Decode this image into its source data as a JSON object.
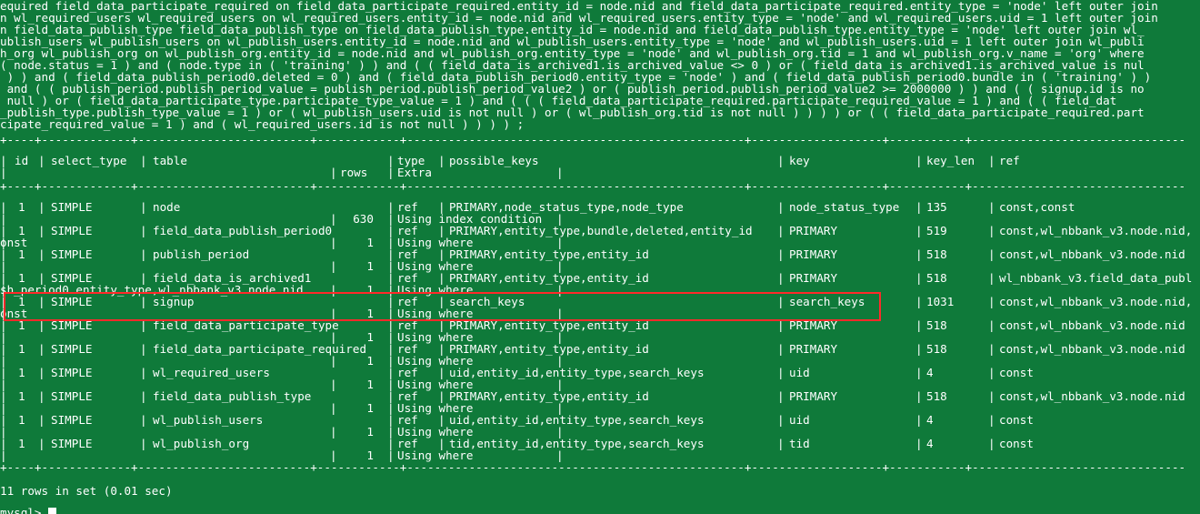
{
  "sql": {
    "lines": [
      "equired field_data_participate_required on field_data_participate_required.entity_id = node.nid and field_data_participate_required.entity_type = 'node' left outer join",
      "n wl_required_users wl_required_users on wl_required_users.entity_id = node.nid and wl_required_users.entity_type = 'node' and wl_required_users.uid = 1 left outer join",
      "n field_data_publish_type field_data_publish_type on field_data_publish_type.entity_id = node.nid and field_data_publish_type.entity_type = 'node' left outer join wl_",
      "ublish_users wl_publish_users on wl_publish_users.entity_id = node.nid and wl_publish_users.entity_type = 'node' and wl_publish_users.uid = 1 left outer join wl_publi",
      "h_org wl_publish_org on wl_publish_org.entity_id = node.nid and wl_publish_org.entity_type = 'node' and wl_publish_org.tid = 1 and wl_publish_org.v_name = 'org' where",
      "( node.status = 1 ) and ( node.type in ( 'training' ) ) and ( ( field_data_is_archived1.is_archived_value <> 0 ) or ( field_data_is_archived1.is_archived_value is nul",
      " ) ) and ( field_data_publish_period0.deleted = 0 ) and ( field_data_publish_period0.entity_type = 'node' ) and ( field_data_publish_period0.bundle in ( 'training' ) )",
      " and ( ( publish_period.publish_period_value = publish_period.publish_period_value2 ) or ( publish_period.publish_period_value2 >= 2000000 ) ) and ( ( signup.id is no",
      " null ) or ( field_data_participate_type.participate_type_value = 1 ) and ( ( ( field_data_participate_required.participate_required_value = 1 ) and ( ( field_dat",
      "_publish_type.publish_type_value = 1 ) or ( wl_publish_users.uid is not null ) or ( wl_publish_org.tid is not null ) ) ) ) or ( ( field_data_participate_required.part",
      "cipate_required_value = 1 ) and ( wl_required_users.id is not null ) ) ) ) ;"
    ]
  },
  "table": {
    "headers": {
      "id": "id",
      "select_type": "select_type",
      "table": "table",
      "type": "type",
      "possible_keys": "possible_keys",
      "key": "key",
      "key_len": "key_len",
      "ref": "ref",
      "rows": "rows",
      "extra": "Extra"
    },
    "rows": [
      {
        "id": "1",
        "select_type": "SIMPLE",
        "table": "node",
        "type": "ref",
        "possible_keys": "PRIMARY,node_status_type,node_type",
        "key": "node_status_type",
        "key_len": "135",
        "ref": "const,const",
        "rows": "630",
        "extra": "Using index condition",
        "overflow": ""
      },
      {
        "id": "1",
        "select_type": "SIMPLE",
        "table": "field_data_publish_period0",
        "type": "ref",
        "possible_keys": "PRIMARY,entity_type,bundle,deleted,entity_id",
        "key": "PRIMARY",
        "key_len": "519",
        "ref": "const,wl_nbbank_v3.node.nid,",
        "rows": "1",
        "extra": "Using where",
        "overflow": "onst"
      },
      {
        "id": "1",
        "select_type": "SIMPLE",
        "table": "publish_period",
        "type": "ref",
        "possible_keys": "PRIMARY,entity_type,entity_id",
        "key": "PRIMARY",
        "key_len": "518",
        "ref": "const,wl_nbbank_v3.node.nid",
        "rows": "1",
        "extra": "Using where",
        "overflow": ""
      },
      {
        "id": "1",
        "select_type": "SIMPLE",
        "table": "field_data_is_archived1",
        "type": "ref",
        "possible_keys": "PRIMARY,entity_type,entity_id",
        "key": "PRIMARY",
        "key_len": "518",
        "ref": "wl_nbbank_v3.field_data_publ",
        "rows": "1",
        "extra": "Using where",
        "overflow": "sh_period0.entity_type,wl_nbbank_v3.node.nid"
      },
      {
        "id": "1",
        "select_type": "SIMPLE",
        "table": "signup",
        "type": "ref",
        "possible_keys": "search_keys",
        "key": "search_keys",
        "key_len": "1031",
        "ref": "const,wl_nbbank_v3.node.nid,",
        "rows": "1",
        "extra": "Using where",
        "overflow": "onst"
      },
      {
        "id": "1",
        "select_type": "SIMPLE",
        "table": "field_data_participate_type",
        "type": "ref",
        "possible_keys": "PRIMARY,entity_type,entity_id",
        "key": "PRIMARY",
        "key_len": "518",
        "ref": "const,wl_nbbank_v3.node.nid",
        "rows": "1",
        "extra": "Using where",
        "overflow": ""
      },
      {
        "id": "1",
        "select_type": "SIMPLE",
        "table": "field_data_participate_required",
        "type": "ref",
        "possible_keys": "PRIMARY,entity_type,entity_id",
        "key": "PRIMARY",
        "key_len": "518",
        "ref": "const,wl_nbbank_v3.node.nid",
        "rows": "1",
        "extra": "Using where",
        "overflow": ""
      },
      {
        "id": "1",
        "select_type": "SIMPLE",
        "table": "wl_required_users",
        "type": "ref",
        "possible_keys": "uid,entity_id,entity_type,search_keys",
        "key": "uid",
        "key_len": "4",
        "ref": "const",
        "rows": "1",
        "extra": "Using where",
        "overflow": ""
      },
      {
        "id": "1",
        "select_type": "SIMPLE",
        "table": "field_data_publish_type",
        "type": "ref",
        "possible_keys": "PRIMARY,entity_type,entity_id",
        "key": "PRIMARY",
        "key_len": "518",
        "ref": "const,wl_nbbank_v3.node.nid",
        "rows": "1",
        "extra": "Using where",
        "overflow": ""
      },
      {
        "id": "1",
        "select_type": "SIMPLE",
        "table": "wl_publish_users",
        "type": "ref",
        "possible_keys": "uid,entity_id,entity_type,search_keys",
        "key": "uid",
        "key_len": "4",
        "ref": "const",
        "rows": "1",
        "extra": "Using where",
        "overflow": ""
      },
      {
        "id": "1",
        "select_type": "SIMPLE",
        "table": "wl_publish_org",
        "type": "ref",
        "possible_keys": "tid,entity_id,entity_type,search_keys",
        "key": "tid",
        "key_len": "4",
        "ref": "const",
        "rows": "1",
        "extra": "Using where",
        "overflow": ""
      }
    ],
    "highlighted_row": "signup"
  },
  "status": {
    "result_summary": "11 rows in set (0.01 sec)",
    "prompt": "mysql>"
  },
  "colors": {
    "background": "#0f7a3a",
    "text": "#ffffff",
    "highlight_border": "#ff2a2a"
  }
}
